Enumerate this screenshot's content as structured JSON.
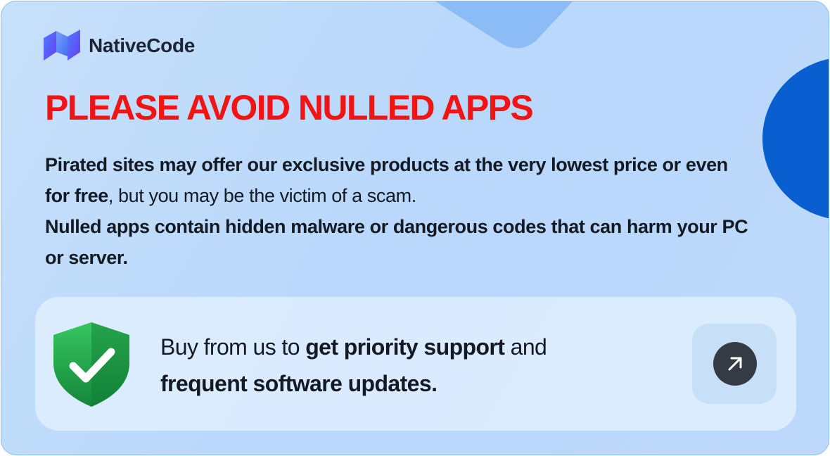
{
  "brand": {
    "name": "NativeCode",
    "colors": {
      "gradient_from": "#3f7bff",
      "gradient_to": "#7b3ff5"
    },
    "icon": "nativecode-logo-icon"
  },
  "headline": "PLEASE AVOID NULLED APPS",
  "description": {
    "line1_bold": "Pirated sites may offer our exclusive products at the very lowest price or even for free",
    "line1_regular": ", but you may be the victim of a scam.",
    "line2_bold": "Nulled apps contain hidden malware or dangerous codes that can harm your PC or server."
  },
  "cta": {
    "text_regular_1": "Buy from us to ",
    "text_bold_1": "get priority support",
    "text_regular_2": " and",
    "text_bold_2": "frequent software updates.",
    "shield_icon": "shield-check-icon",
    "arrow_icon": "arrow-up-right-icon"
  },
  "colors": {
    "headline": "#f01414",
    "accent_blue": "#0a5fd0",
    "shield_green": "#1c9a3e",
    "arrow_button": "#353b44"
  }
}
